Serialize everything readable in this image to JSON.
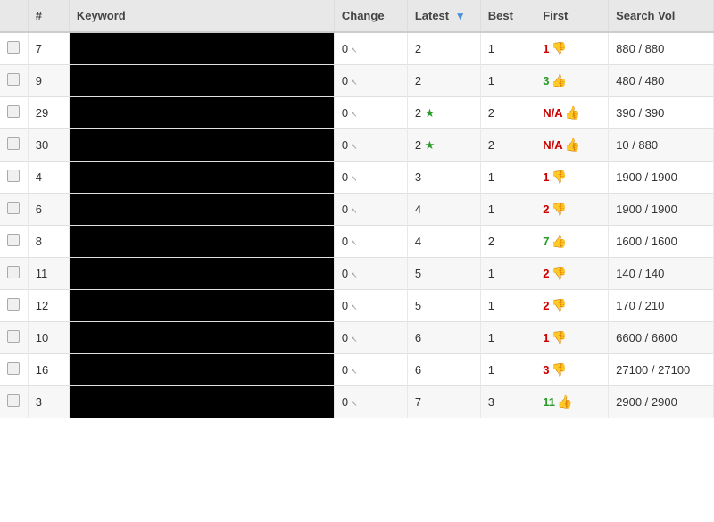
{
  "table": {
    "headers": {
      "checkbox": "",
      "hash": "#",
      "keyword": "Keyword",
      "change": "Change",
      "latest": "Latest",
      "best": "Best",
      "first": "First",
      "search_vol": "Search Vol"
    },
    "rows": [
      {
        "id": 1,
        "num": 7,
        "change": "0",
        "latest": "2",
        "latest_star": false,
        "best": "1",
        "first": "1",
        "first_color": "red",
        "search_vol": "880 / 880",
        "thumb": "down"
      },
      {
        "id": 2,
        "num": 9,
        "change": "0",
        "latest": "2",
        "latest_star": false,
        "best": "1",
        "first": "3",
        "first_color": "green",
        "search_vol": "480 / 480",
        "thumb": "up"
      },
      {
        "id": 3,
        "num": 29,
        "change": "0",
        "latest": "2",
        "latest_star": true,
        "best": "2",
        "first": "N/A",
        "first_color": "red",
        "search_vol": "390 / 390",
        "thumb": "up"
      },
      {
        "id": 4,
        "num": 30,
        "change": "0",
        "latest": "2",
        "latest_star": true,
        "best": "2",
        "first": "N/A",
        "first_color": "red",
        "search_vol": "10 / 880",
        "thumb": "up"
      },
      {
        "id": 5,
        "num": 4,
        "change": "0",
        "latest": "3",
        "latest_star": false,
        "best": "1",
        "first": "1",
        "first_color": "red",
        "search_vol": "1900 / 1900",
        "thumb": "down"
      },
      {
        "id": 6,
        "num": 6,
        "change": "0",
        "latest": "4",
        "latest_star": false,
        "best": "1",
        "first": "2",
        "first_color": "red",
        "search_vol": "1900 / 1900",
        "thumb": "down"
      },
      {
        "id": 7,
        "num": 8,
        "change": "0",
        "latest": "4",
        "latest_star": false,
        "best": "2",
        "first": "7",
        "first_color": "green",
        "search_vol": "1600 / 1600",
        "thumb": "up"
      },
      {
        "id": 8,
        "num": 11,
        "change": "0",
        "latest": "5",
        "latest_star": false,
        "best": "1",
        "first": "2",
        "first_color": "red",
        "search_vol": "140 / 140",
        "thumb": "down"
      },
      {
        "id": 9,
        "num": 12,
        "change": "0",
        "latest": "5",
        "latest_star": false,
        "best": "1",
        "first": "2",
        "first_color": "red",
        "search_vol": "170 / 210",
        "thumb": "down"
      },
      {
        "id": 10,
        "num": 10,
        "change": "0",
        "latest": "6",
        "latest_star": false,
        "best": "1",
        "first": "1",
        "first_color": "red",
        "search_vol": "6600 / 6600",
        "thumb": "down"
      },
      {
        "id": 11,
        "num": 16,
        "change": "0",
        "latest": "6",
        "latest_star": false,
        "best": "1",
        "first": "3",
        "first_color": "red",
        "search_vol": "27100 / 27100",
        "thumb": "down"
      },
      {
        "id": 12,
        "num": 3,
        "change": "0",
        "latest": "7",
        "latest_star": false,
        "best": "3",
        "first": "11",
        "first_color": "green",
        "search_vol": "2900 / 2900",
        "thumb": "up"
      }
    ]
  }
}
